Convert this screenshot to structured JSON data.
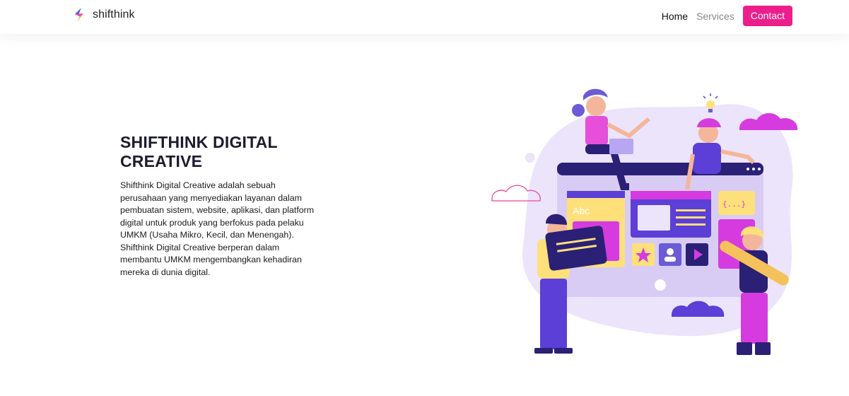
{
  "brand": {
    "name": "shifthink",
    "logo_icon": "shifthink-logo-icon",
    "colors": {
      "logo_pink": "#ec4899",
      "logo_orange": "#f5a623",
      "logo_blue": "#4a5de8"
    }
  },
  "nav": {
    "items": [
      {
        "label": "Home",
        "active": true
      },
      {
        "label": "Services",
        "active": false
      }
    ],
    "contact_label": "Contact",
    "contact_color": "#ec1e8c"
  },
  "hero": {
    "title": "SHIFTHINK DIGITAL CREATIVE",
    "description": "Shifthink Digital Creative adalah sebuah perusahaan yang menyediakan layanan dalam pembuatan sistem, website, aplikasi, dan platform digital untuk produk yang berfokus pada pelaku UMKM (Usaha Mikro, Kecil, dan Menengah). Shifthink Digital Creative berperan dalam membantu UMKM mengembangkan kehadiran mereka di dunia digital.",
    "illustration": {
      "icon": "team-web-design-illustration",
      "card_label": "Abc",
      "code_label": "{...}",
      "colors": {
        "purple": "#5b3fd6",
        "magenta": "#d63be0",
        "yellow": "#fde07a",
        "lavender": "#ece4fb"
      }
    }
  }
}
